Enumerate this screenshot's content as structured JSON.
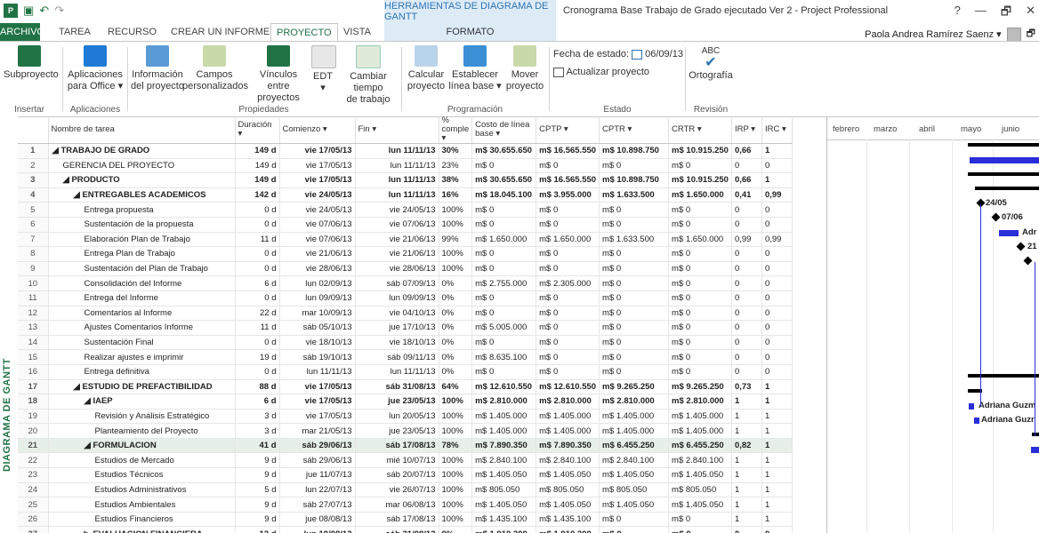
{
  "titlebar": {
    "context_header": "HERRAMIENTAS DE DIAGRAMA DE GANTT",
    "doc_title": "Cronograma Base Trabajo de Grado ejecutado Ver 2 - Project Professional",
    "app_icon": "P",
    "help": "?",
    "minimize": "—",
    "restore": "🗗",
    "close": "✕"
  },
  "tabs": {
    "file": "ARCHIVO",
    "task": "TAREA",
    "resource": "RECURSO",
    "report": "CREAR UN INFORME",
    "project": "PROYECTO",
    "view": "VISTA",
    "format": "FORMATO"
  },
  "user": {
    "name": "Paola Andrea Ramírez Saenz ▾"
  },
  "ribbon": {
    "subproject": "Subproyecto",
    "apps": "Aplicaciones",
    "apps2": "para Office ▾",
    "info": "Información",
    "info2": "del proyecto",
    "fields": "Campos",
    "fields2": "personalizados",
    "links": "Vínculos entre",
    "links2": "proyectos",
    "wbs": "EDT",
    "wbs2": "▾",
    "worktime": "Cambiar tiempo",
    "worktime2": "de trabajo",
    "calc": "Calcular",
    "calc2": "proyecto",
    "baseline": "Establecer",
    "baseline2": "línea base ▾",
    "move": "Mover",
    "move2": "proyecto",
    "status_date_label": "Fecha de estado:",
    "status_date": "06/09/13",
    "update": "Actualizar proyecto",
    "spelling": "Ortografía",
    "g_insert": "Insertar",
    "g_apps": "Aplicaciones",
    "g_props": "Propiedades",
    "g_sched": "Programación",
    "g_status": "Estado",
    "g_review": "Revisión"
  },
  "side_tab": "DIAGRAMA DE GANTT",
  "columns": [
    "",
    "Nombre de tarea",
    "Duración ▾",
    "Comienzo ▾",
    "Fin ▾",
    "% comple ▾",
    "Costo de línea base ▾",
    "CPTP ▾",
    "CPTR ▾",
    "CRTR ▾",
    "IRP ▾",
    "IRC ▾"
  ],
  "rows": [
    {
      "id": "1",
      "name": "◢ TRABAJO DE GRADO",
      "dur": "149 d",
      "start": "vie 17/05/13",
      "end": "lun 11/11/13",
      "pct": "30%",
      "base": "m$ 30.655.650",
      "cptp": "m$ 16.565.550",
      "cptr": "m$ 10.898.750",
      "crtr": "m$ 10.915.250",
      "irp": "0,66",
      "irc": "1",
      "lvl": 0,
      "sum": true
    },
    {
      "id": "2",
      "name": "GERENCIA DEL PROYECTO",
      "dur": "149 d",
      "start": "vie 17/05/13",
      "end": "lun 11/11/13",
      "pct": "23%",
      "base": "m$ 0",
      "cptp": "m$ 0",
      "cptr": "m$ 0",
      "crtr": "m$ 0",
      "irp": "0",
      "irc": "0",
      "lvl": 1,
      "sum": false
    },
    {
      "id": "3",
      "name": "◢ PRODUCTO",
      "dur": "149 d",
      "start": "vie 17/05/13",
      "end": "lun 11/11/13",
      "pct": "38%",
      "base": "m$ 30.655.650",
      "cptp": "m$ 16.565.550",
      "cptr": "m$ 10.898.750",
      "crtr": "m$ 10.915.250",
      "irp": "0,66",
      "irc": "1",
      "lvl": 1,
      "sum": true
    },
    {
      "id": "4",
      "name": "◢ ENTREGABLES ACADEMICOS",
      "dur": "142 d",
      "start": "vie 24/05/13",
      "end": "lun 11/11/13",
      "pct": "16%",
      "base": "m$ 18.045.100",
      "cptp": "m$ 3.955.000",
      "cptr": "m$ 1.633.500",
      "crtr": "m$ 1.650.000",
      "irp": "0,41",
      "irc": "0,99",
      "lvl": 2,
      "sum": true
    },
    {
      "id": "5",
      "name": "Entrega propuesta",
      "dur": "0 d",
      "start": "vie 24/05/13",
      "end": "vie 24/05/13",
      "pct": "100%",
      "base": "m$ 0",
      "cptp": "m$ 0",
      "cptr": "m$ 0",
      "crtr": "m$ 0",
      "irp": "0",
      "irc": "0",
      "lvl": 3,
      "sum": false
    },
    {
      "id": "6",
      "name": "Sustentación de la propuesta",
      "dur": "0 d",
      "start": "vie 07/06/13",
      "end": "vie 07/06/13",
      "pct": "100%",
      "base": "m$ 0",
      "cptp": "m$ 0",
      "cptr": "m$ 0",
      "crtr": "m$ 0",
      "irp": "0",
      "irc": "0",
      "lvl": 3,
      "sum": false
    },
    {
      "id": "7",
      "name": "Elaboración Plan de Trabajo",
      "dur": "11 d",
      "start": "vie 07/06/13",
      "end": "vie 21/06/13",
      "pct": "99%",
      "base": "m$ 1.650.000",
      "cptp": "m$ 1.650.000",
      "cptr": "m$ 1.633.500",
      "crtr": "m$ 1.650.000",
      "irp": "0,99",
      "irc": "0,99",
      "lvl": 3,
      "sum": false
    },
    {
      "id": "8",
      "name": "Entrega Plan de Trabajo",
      "dur": "0 d",
      "start": "vie 21/06/13",
      "end": "vie 21/06/13",
      "pct": "100%",
      "base": "m$ 0",
      "cptp": "m$ 0",
      "cptr": "m$ 0",
      "crtr": "m$ 0",
      "irp": "0",
      "irc": "0",
      "lvl": 3,
      "sum": false
    },
    {
      "id": "9",
      "name": "Sustentación del Plan de Trabajo",
      "dur": "0 d",
      "start": "vie 28/06/13",
      "end": "vie 28/06/13",
      "pct": "100%",
      "base": "m$ 0",
      "cptp": "m$ 0",
      "cptr": "m$ 0",
      "crtr": "m$ 0",
      "irp": "0",
      "irc": "0",
      "lvl": 3,
      "sum": false
    },
    {
      "id": "10",
      "name": "Consolidación del Informe",
      "dur": "6 d",
      "start": "lun 02/09/13",
      "end": "sáb 07/09/13",
      "pct": "0%",
      "base": "m$ 2.755.000",
      "cptp": "m$ 2.305.000",
      "cptr": "m$ 0",
      "crtr": "m$ 0",
      "irp": "0",
      "irc": "0",
      "lvl": 3,
      "sum": false
    },
    {
      "id": "11",
      "name": "Entrega del Informe",
      "dur": "0 d",
      "start": "lun 09/09/13",
      "end": "lun 09/09/13",
      "pct": "0%",
      "base": "m$ 0",
      "cptp": "m$ 0",
      "cptr": "m$ 0",
      "crtr": "m$ 0",
      "irp": "0",
      "irc": "0",
      "lvl": 3,
      "sum": false
    },
    {
      "id": "12",
      "name": "Comentarios al Informe",
      "dur": "22 d",
      "start": "mar 10/09/13",
      "end": "vie 04/10/13",
      "pct": "0%",
      "base": "m$ 0",
      "cptp": "m$ 0",
      "cptr": "m$ 0",
      "crtr": "m$ 0",
      "irp": "0",
      "irc": "0",
      "lvl": 3,
      "sum": false
    },
    {
      "id": "13",
      "name": "Ajustes Comentarios Informe",
      "dur": "11 d",
      "start": "sáb 05/10/13",
      "end": "jue 17/10/13",
      "pct": "0%",
      "base": "m$ 5.005.000",
      "cptp": "m$ 0",
      "cptr": "m$ 0",
      "crtr": "m$ 0",
      "irp": "0",
      "irc": "0",
      "lvl": 3,
      "sum": false
    },
    {
      "id": "14",
      "name": "Sustentación Final",
      "dur": "0 d",
      "start": "vie 18/10/13",
      "end": "vie 18/10/13",
      "pct": "0%",
      "base": "m$ 0",
      "cptp": "m$ 0",
      "cptr": "m$ 0",
      "crtr": "m$ 0",
      "irp": "0",
      "irc": "0",
      "lvl": 3,
      "sum": false
    },
    {
      "id": "15",
      "name": "Realizar ajustes e imprimir",
      "dur": "19 d",
      "start": "sáb 19/10/13",
      "end": "sáb 09/11/13",
      "pct": "0%",
      "base": "m$ 8.635.100",
      "cptp": "m$ 0",
      "cptr": "m$ 0",
      "crtr": "m$ 0",
      "irp": "0",
      "irc": "0",
      "lvl": 3,
      "sum": false
    },
    {
      "id": "16",
      "name": "Entrega definitiva",
      "dur": "0 d",
      "start": "lun 11/11/13",
      "end": "lun 11/11/13",
      "pct": "0%",
      "base": "m$ 0",
      "cptp": "m$ 0",
      "cptr": "m$ 0",
      "crtr": "m$ 0",
      "irp": "0",
      "irc": "0",
      "lvl": 3,
      "sum": false
    },
    {
      "id": "17",
      "name": "◢ ESTUDIO DE PREFACTIBILIDAD",
      "dur": "88 d",
      "start": "vie 17/05/13",
      "end": "sáb 31/08/13",
      "pct": "64%",
      "base": "m$ 12.610.550",
      "cptp": "m$ 12.610.550",
      "cptr": "m$ 9.265.250",
      "crtr": "m$ 9.265.250",
      "irp": "0,73",
      "irc": "1",
      "lvl": 2,
      "sum": true
    },
    {
      "id": "18",
      "name": "◢ IAEP",
      "dur": "6 d",
      "start": "vie 17/05/13",
      "end": "jue 23/05/13",
      "pct": "100%",
      "base": "m$ 2.810.000",
      "cptp": "m$ 2.810.000",
      "cptr": "m$ 2.810.000",
      "crtr": "m$ 2.810.000",
      "irp": "1",
      "irc": "1",
      "lvl": 3,
      "sum": true
    },
    {
      "id": "19",
      "name": "Revisión y Análisis Estratégico",
      "dur": "3 d",
      "start": "vie 17/05/13",
      "end": "lun 20/05/13",
      "pct": "100%",
      "base": "m$ 1.405.000",
      "cptp": "m$ 1.405.000",
      "cptr": "m$ 1.405.000",
      "crtr": "m$ 1.405.000",
      "irp": "1",
      "irc": "1",
      "lvl": 4,
      "sum": false
    },
    {
      "id": "20",
      "name": "Planteamiento del Proyecto",
      "dur": "3 d",
      "start": "mar 21/05/13",
      "end": "jue 23/05/13",
      "pct": "100%",
      "base": "m$ 1.405.000",
      "cptp": "m$ 1.405.000",
      "cptr": "m$ 1.405.000",
      "crtr": "m$ 1.405.000",
      "irp": "1",
      "irc": "1",
      "lvl": 4,
      "sum": false
    },
    {
      "id": "21",
      "name": "◢ FORMULACION",
      "dur": "41 d",
      "start": "sáb 29/06/13",
      "end": "sáb 17/08/13",
      "pct": "78%",
      "base": "m$ 7.890.350",
      "cptp": "m$ 7.890.350",
      "cptr": "m$ 6.455.250",
      "crtr": "m$ 6.455.250",
      "irp": "0,82",
      "irc": "1",
      "lvl": 3,
      "sum": true,
      "sel": true
    },
    {
      "id": "22",
      "name": "Estudios de Mercado",
      "dur": "9 d",
      "start": "sáb 29/06/13",
      "end": "mié 10/07/13",
      "pct": "100%",
      "base": "m$ 2.840.100",
      "cptp": "m$ 2.840.100",
      "cptr": "m$ 2.840.100",
      "crtr": "m$ 2.840.100",
      "irp": "1",
      "irc": "1",
      "lvl": 4,
      "sum": false
    },
    {
      "id": "23",
      "name": "Estudios Técnicos",
      "dur": "9 d",
      "start": "jue 11/07/13",
      "end": "sáb 20/07/13",
      "pct": "100%",
      "base": "m$ 1.405.050",
      "cptp": "m$ 1.405.050",
      "cptr": "m$ 1.405.050",
      "crtr": "m$ 1.405.050",
      "irp": "1",
      "irc": "1",
      "lvl": 4,
      "sum": false
    },
    {
      "id": "24",
      "name": "Estudios Administrativos",
      "dur": "5 d",
      "start": "lun 22/07/13",
      "end": "vie 26/07/13",
      "pct": "100%",
      "base": "m$ 805.050",
      "cptp": "m$ 805.050",
      "cptr": "m$ 805.050",
      "crtr": "m$ 805.050",
      "irp": "1",
      "irc": "1",
      "lvl": 4,
      "sum": false
    },
    {
      "id": "25",
      "name": "Estudios Ambientales",
      "dur": "9 d",
      "start": "sáb 27/07/13",
      "end": "mar 06/08/13",
      "pct": "100%",
      "base": "m$ 1.405.050",
      "cptp": "m$ 1.405.050",
      "cptr": "m$ 1.405.050",
      "crtr": "m$ 1.405.050",
      "irp": "1",
      "irc": "1",
      "lvl": 4,
      "sum": false
    },
    {
      "id": "26",
      "name": "Estudios Financieros",
      "dur": "9 d",
      "start": "jue 08/08/13",
      "end": "sáb 17/08/13",
      "pct": "100%",
      "base": "m$ 1.435.100",
      "cptp": "m$ 1.435.100",
      "cptr": "m$ 0",
      "crtr": "m$ 0",
      "irp": "1",
      "irc": "1",
      "lvl": 4,
      "sum": false
    },
    {
      "id": "27",
      "name": "▷ EVALUACION FINANCIERA",
      "dur": "12 d",
      "start": "lun 19/08/13",
      "end": "sáb 31/08/13",
      "pct": "0%",
      "base": "m$ 1.910.200",
      "cptp": "m$ 1.910.200",
      "cptr": "m$ 0",
      "crtr": "m$ 0",
      "irp": "0",
      "irc": "0",
      "lvl": 3,
      "sum": true
    }
  ],
  "gantt": {
    "months": [
      "febrero",
      "marzo",
      "abril",
      "mayo",
      "junio"
    ],
    "label_2405": "24/05",
    "label_0706": "07/06",
    "label_adr": "Adr",
    "label_21": "21",
    "label_adriana1": "Adriana Guzm",
    "label_adriana2": "Adriana Guzr"
  },
  "colors": {
    "accent": "#217346",
    "bar": "#2a2ed8",
    "summary": "#000000"
  }
}
